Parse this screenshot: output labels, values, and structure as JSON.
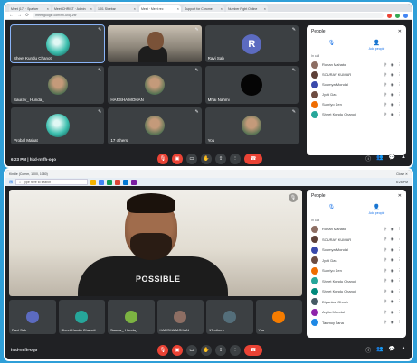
{
  "top": {
    "tabs": [
      "Meet (17) · Sparker",
      "Meet CHRIST · Admin",
      "1:01 Sidebar",
      "Meet · Meet rec",
      "Support for Chrome",
      "Number Fight Online"
    ],
    "url": "meet.google.com/rhi-uxqr-zxr",
    "tiles": [
      {
        "name": "Sheet Kundu Chanoti",
        "type": "globe",
        "speaking": true
      },
      {
        "name": "",
        "type": "video",
        "speaking": false
      },
      {
        "name": "Ravi Sab",
        "type": "letter",
        "letter": "R",
        "speaking": false
      },
      {
        "name": "Saurav_ Hunda_",
        "type": "photo",
        "speaking": false
      },
      {
        "name": "HARSHA MOHAN",
        "type": "photo",
        "speaking": false
      },
      {
        "name": "Mhai Nahmi",
        "type": "dark",
        "speaking": false
      },
      {
        "name": "Probal Mahat",
        "type": "globe",
        "speaking": false
      },
      {
        "name": "17 others",
        "type": "photo",
        "speaking": false
      },
      {
        "name": "You",
        "type": "photo",
        "speaking": false
      }
    ],
    "meeting_info": "6:23 PM | hkd-rmfh-oqo",
    "panel": {
      "title": "People",
      "add_people": "Add people",
      "section": "In call",
      "participants": [
        {
          "name": "Rohan Mahato",
          "color": "#8d6e63"
        },
        {
          "name": "SOURAV KUMAR",
          "color": "#5d4037"
        },
        {
          "name": "Soumya Mondal",
          "color": "#3949ab"
        },
        {
          "name": "Jyoti Das",
          "color": "#6d4c41"
        },
        {
          "name": "Supriyo Sen",
          "color": "#ef6c00"
        },
        {
          "name": "Sheet Kundu Chanoti",
          "color": "#26a69a"
        }
      ]
    }
  },
  "bottom": {
    "window_title": "Kindle (Comm, 1000, 1080)",
    "close_label": "Close ✕",
    "search_placeholder": "Type here to search",
    "clock": "6:26 PM",
    "shirt": "POSSIBLE",
    "film_tiles": [
      {
        "name": "Ravi Sab",
        "color": "#5c6bc0"
      },
      {
        "name": "Sheet Kundu Chanoti",
        "color": "#26a69a"
      },
      {
        "name": "Saurav_ Hunda_",
        "color": "#7cb342"
      },
      {
        "name": "HARSHA MOHAN",
        "color": "#8d6e63"
      },
      {
        "name": "17 others",
        "color": "#546e7a"
      },
      {
        "name": "You",
        "color": "#f57c00"
      }
    ],
    "meeting_info": "hkd-rmfh-oqo",
    "panel": {
      "title": "People",
      "add_people": "Add people",
      "section": "In call",
      "participants": [
        {
          "name": "Rohan Mahato",
          "color": "#8d6e63"
        },
        {
          "name": "SOURAV KUMAR",
          "color": "#5d4037"
        },
        {
          "name": "Soumya Mondal",
          "color": "#3949ab"
        },
        {
          "name": "Jyoti Das",
          "color": "#6d4c41"
        },
        {
          "name": "Supriyo Sen",
          "color": "#ef6c00"
        },
        {
          "name": "Sheet Kundu Chanoti",
          "color": "#26a69a"
        },
        {
          "name": "Sheet Kundu Chanoti",
          "color": "#00897b"
        },
        {
          "name": "Dipankar Ghosh",
          "color": "#455a64"
        },
        {
          "name": "Arpita Mondal",
          "color": "#8e24aa"
        },
        {
          "name": "Tanmoy Jana",
          "color": "#1e88e5"
        }
      ]
    }
  }
}
